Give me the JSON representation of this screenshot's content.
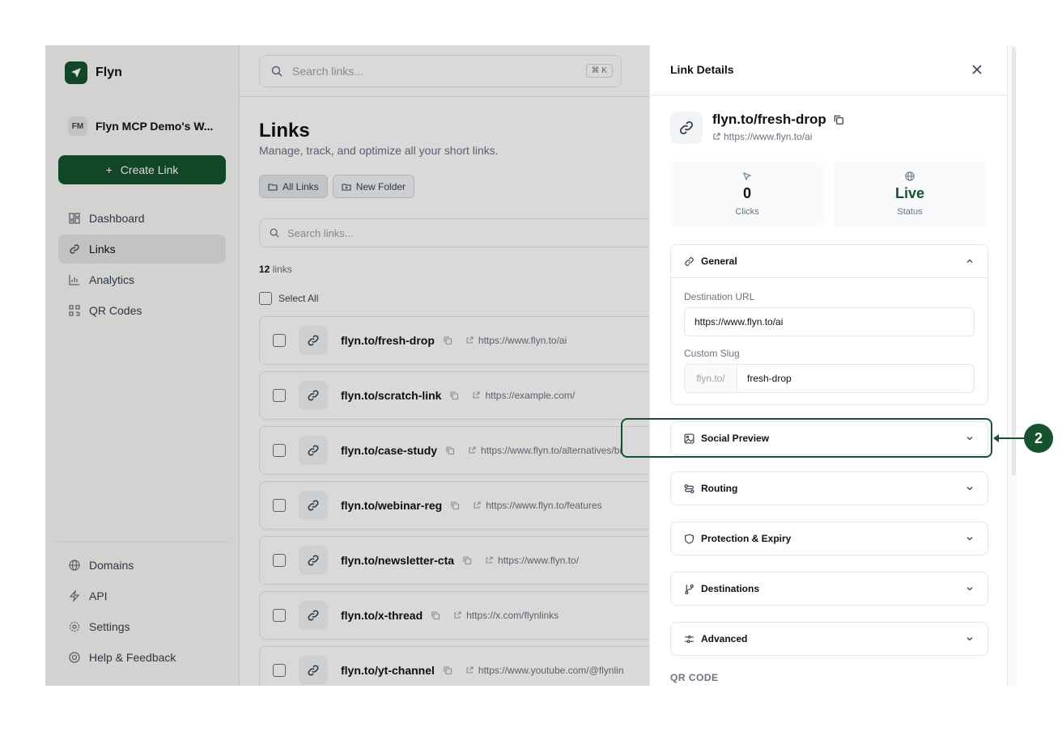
{
  "brand": {
    "name": "Flyn"
  },
  "workspace": {
    "initials": "FM",
    "name": "Flyn MCP Demo's W..."
  },
  "sidebar": {
    "create_label": "Create Link",
    "items": [
      {
        "label": "Dashboard",
        "icon": "dashboard-icon"
      },
      {
        "label": "Links",
        "icon": "link-icon",
        "active": true
      },
      {
        "label": "Analytics",
        "icon": "bar-chart-icon"
      },
      {
        "label": "QR Codes",
        "icon": "qr-code-icon"
      }
    ],
    "bottom_items": [
      {
        "label": "Domains",
        "icon": "globe-icon"
      },
      {
        "label": "API",
        "icon": "lightning-icon"
      },
      {
        "label": "Settings",
        "icon": "gear-icon"
      },
      {
        "label": "Help & Feedback",
        "icon": "lifebuoy-icon"
      }
    ]
  },
  "topbar": {
    "search_placeholder": "Search links...",
    "shortcut": "⌘ K"
  },
  "main": {
    "title": "Links",
    "subtitle": "Manage, track, and optimize all your short links.",
    "folders": {
      "all": "All Links",
      "new": "New Folder"
    },
    "list_search_placeholder": "Search links...",
    "count_number": "12",
    "count_suffix": " links",
    "select_all": "Select All",
    "rows": [
      {
        "short": "flyn.to/fresh-drop",
        "url": "https://www.flyn.to/ai"
      },
      {
        "short": "flyn.to/scratch-link",
        "url": "https://example.com/"
      },
      {
        "short": "flyn.to/case-study",
        "url": "https://www.flyn.to/alternatives/bi"
      },
      {
        "short": "flyn.to/webinar-reg",
        "url": "https://www.flyn.to/features"
      },
      {
        "short": "flyn.to/newsletter-cta",
        "url": "https://www.flyn.to/"
      },
      {
        "short": "flyn.to/x-thread",
        "url": "https://x.com/flynlinks"
      },
      {
        "short": "flyn.to/yt-channel",
        "url": "https://www.youtube.com/@flynlin"
      }
    ]
  },
  "drawer": {
    "title": "Link Details",
    "short": "flyn.to/fresh-drop",
    "url": "https://www.flyn.to/ai",
    "stats": {
      "clicks_value": "0",
      "clicks_label": "Clicks",
      "status_value": "Live",
      "status_label": "Status"
    },
    "general": {
      "title": "General",
      "dest_label": "Destination URL",
      "dest_value": "https://www.flyn.to/ai",
      "slug_label": "Custom Slug",
      "slug_prefix": "flyn.to/",
      "slug_value": "fresh-drop"
    },
    "sections": {
      "social": "Social Preview",
      "routing": "Routing",
      "protection": "Protection & Expiry",
      "destinations": "Destinations",
      "advanced": "Advanced"
    },
    "qr_label": "QR CODE"
  },
  "callout": {
    "number": "2"
  },
  "colors": {
    "accent": "#14532d",
    "live": "#14532d"
  }
}
